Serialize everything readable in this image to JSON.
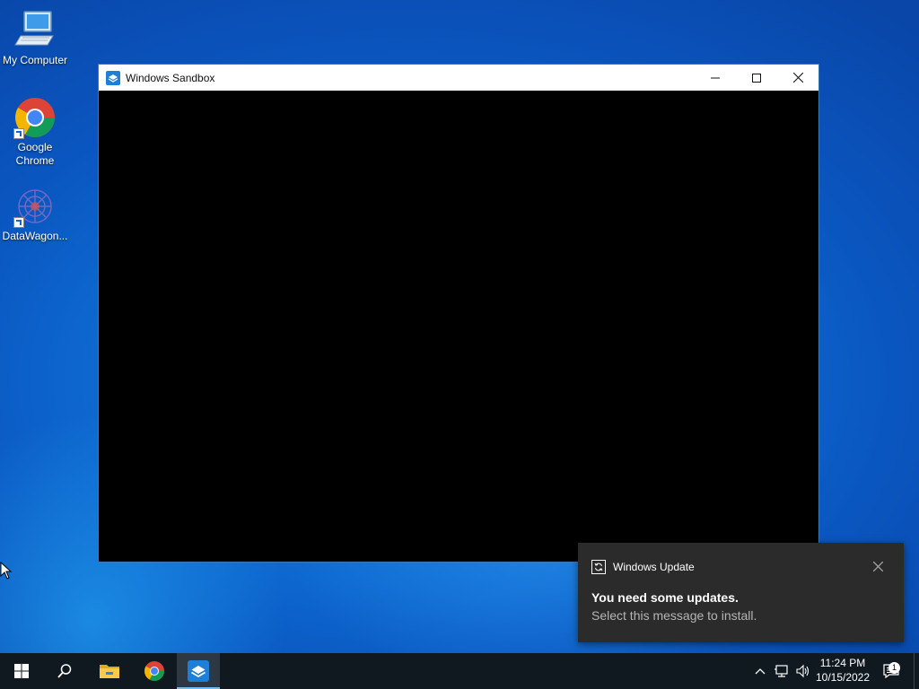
{
  "desktop": {
    "icons": [
      {
        "label": "My Computer"
      },
      {
        "label": "Google Chrome"
      },
      {
        "label": "DataWagon..."
      }
    ]
  },
  "window": {
    "title": "Windows Sandbox",
    "controls": [
      "minimize",
      "maximize",
      "close"
    ]
  },
  "notification": {
    "app": "Windows Update",
    "title": "You need some updates.",
    "body": "Select this message to install."
  },
  "taskbar": {
    "items": [
      "start",
      "search",
      "file-explorer",
      "chrome",
      "windows-sandbox"
    ],
    "active": "windows-sandbox",
    "clock": {
      "time": "11:24 PM",
      "date": "10/15/2022"
    },
    "notification_count": "1"
  },
  "colors": {
    "taskbar_bg": "#101820",
    "toast_bg": "#2b2b2b",
    "accent": "#76b9ed"
  }
}
